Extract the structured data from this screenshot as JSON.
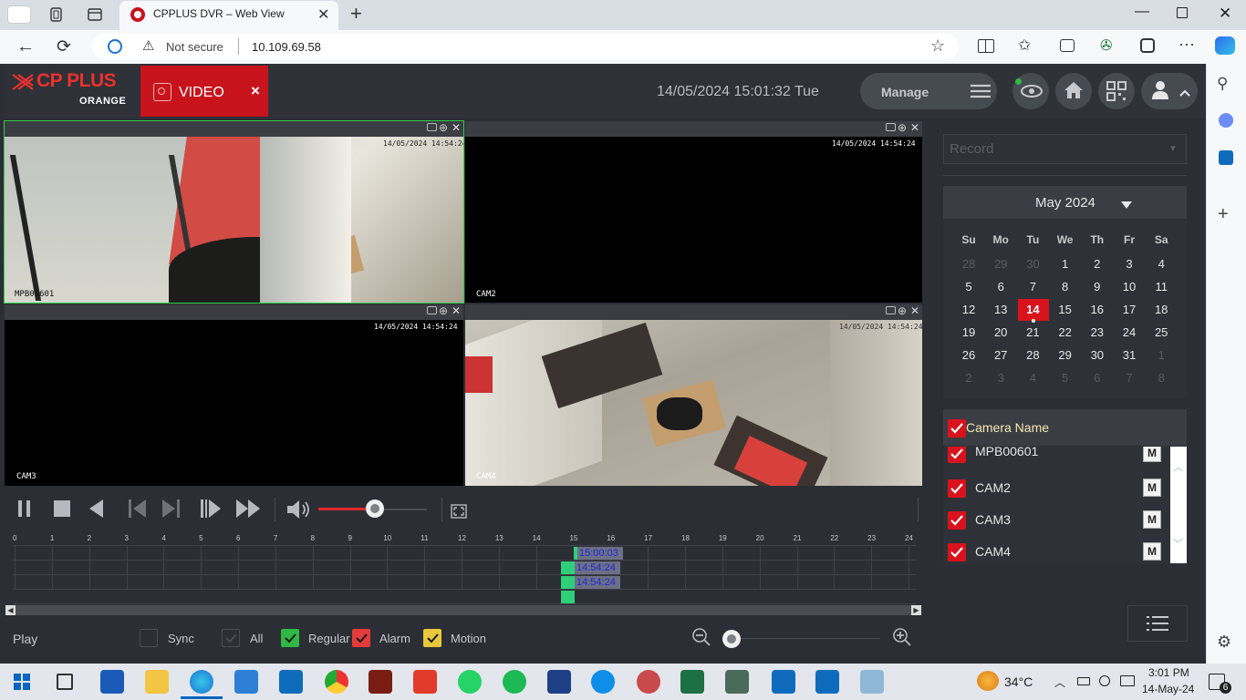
{
  "browser": {
    "tab_title": "CPPLUS DVR – Web View",
    "security_label": "Not secure",
    "url": "10.109.69.58"
  },
  "app": {
    "logo_main": "CP PLUS",
    "logo_sub": "ORANGE",
    "video_tab_label": "VIDEO",
    "close_glyph": "×",
    "datetime": "14/05/2024 15:01:32 Tue",
    "manage_label": "Manage"
  },
  "cameras": [
    {
      "label": "MPB00601",
      "timestamp": "14/05/2024 14:54:24"
    },
    {
      "label": "CAM2",
      "timestamp": "14/05/2024 14:54:24"
    },
    {
      "label": "CAM3",
      "timestamp": "14/05/2024 14:54:24"
    },
    {
      "label": "CAM4",
      "timestamp": "14/05/2024 14:54:24"
    }
  ],
  "timeline": {
    "hours": [
      "0",
      "1",
      "2",
      "3",
      "4",
      "5",
      "6",
      "7",
      "8",
      "9",
      "10",
      "11",
      "12",
      "13",
      "14",
      "15",
      "16",
      "17",
      "18",
      "19",
      "20",
      "21",
      "22",
      "23",
      "24"
    ],
    "markers": [
      "15:00:03",
      "14:54:24",
      "14:54:24"
    ]
  },
  "bottom": {
    "play_label": "Play",
    "sync_label": "Sync",
    "all_label": "All",
    "regular_label": "Regular",
    "alarm_label": "Alarm",
    "motion_label": "Motion",
    "regular_color": "#2fb844",
    "alarm_color": "#e43b3b",
    "motion_color": "#e8c83a"
  },
  "record": {
    "dropdown_value": "Record"
  },
  "calendar": {
    "month_label": "May 2024",
    "weekdays": [
      "Su",
      "Mo",
      "Tu",
      "We",
      "Th",
      "Fr",
      "Sa"
    ],
    "weeks": [
      [
        "28",
        "29",
        "30",
        "1",
        "2",
        "3",
        "4"
      ],
      [
        "5",
        "6",
        "7",
        "8",
        "9",
        "10",
        "11"
      ],
      [
        "12",
        "13",
        "14",
        "15",
        "16",
        "17",
        "18"
      ],
      [
        "19",
        "20",
        "21",
        "22",
        "23",
        "24",
        "25"
      ],
      [
        "26",
        "27",
        "28",
        "29",
        "30",
        "31",
        "1"
      ],
      [
        "2",
        "3",
        "4",
        "5",
        "6",
        "7",
        "8"
      ]
    ],
    "selected_day": "14"
  },
  "camera_list": {
    "header": "Camera Name",
    "items": [
      {
        "name": "MPB00601",
        "badge": "M"
      },
      {
        "name": "CAM2",
        "badge": "M"
      },
      {
        "name": "CAM3",
        "badge": "M"
      },
      {
        "name": "CAM4",
        "badge": "M"
      }
    ]
  },
  "taskbar": {
    "temperature": "34°C",
    "time": "3:01 PM",
    "date": "14-May-24",
    "notification_count": "6"
  }
}
